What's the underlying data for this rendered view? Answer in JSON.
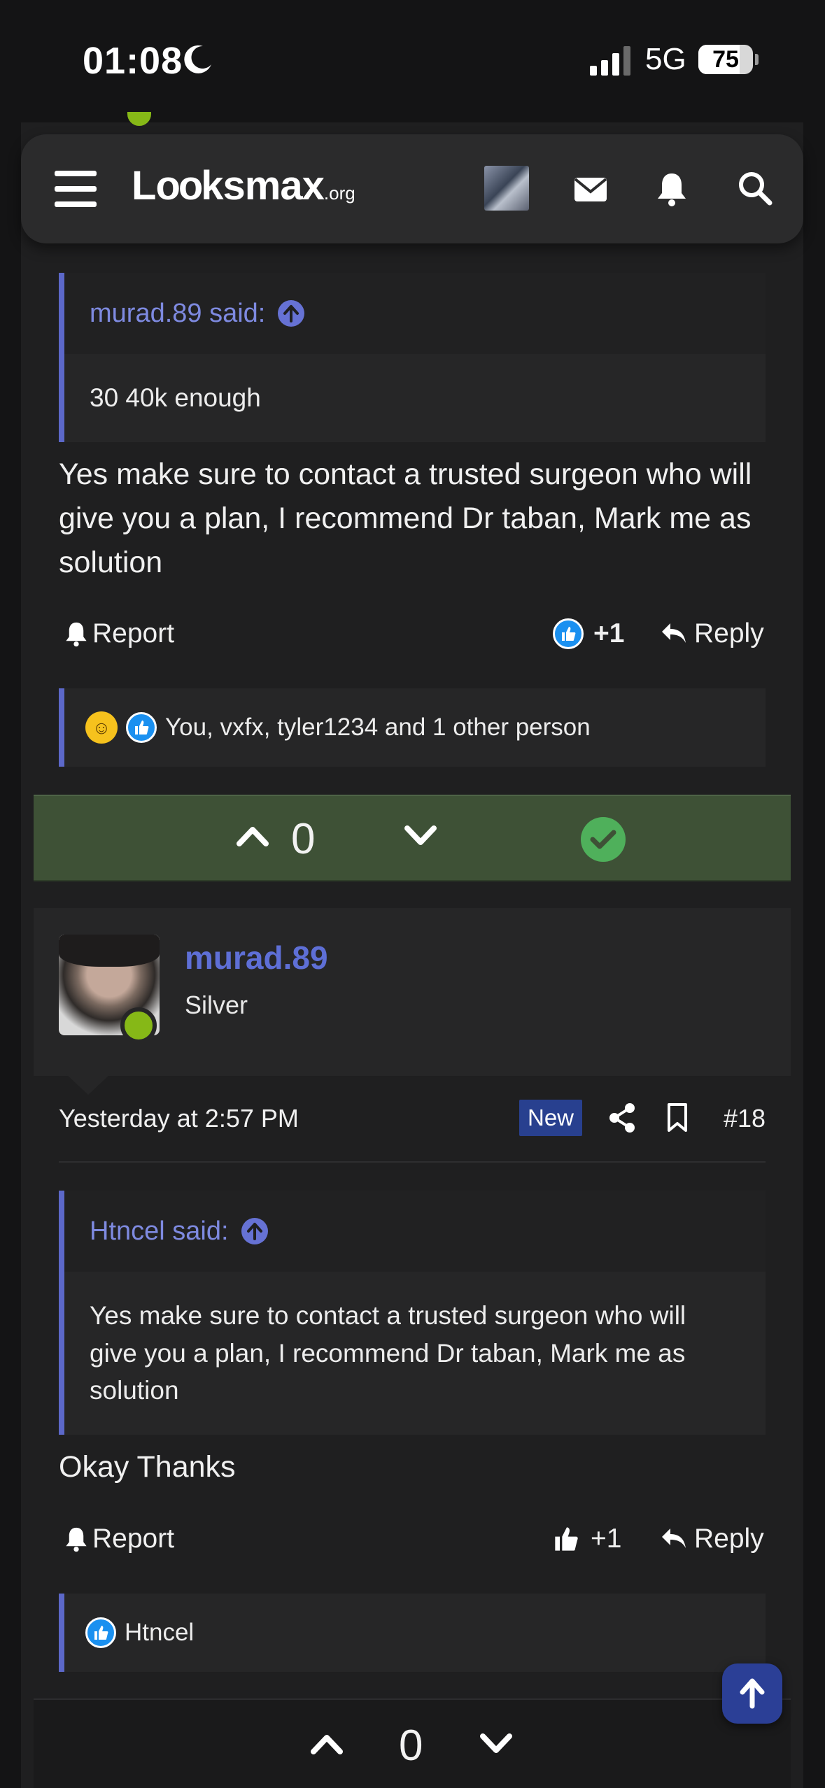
{
  "status_bar": {
    "time": "01:08",
    "network": "5G",
    "battery": "75",
    "battery_level": 0.75
  },
  "header": {
    "logo_main_1": "L",
    "logo_oo": "oo",
    "logo_main_2": "ksmax",
    "logo_suffix": ".org",
    "icons": [
      "menu-icon",
      "avatar",
      "mail-icon",
      "bell-icon",
      "search-icon"
    ]
  },
  "post1": {
    "quote_author": "murad.89 said:",
    "quote_text": "30 40k enough",
    "text": "Yes make sure to contact a trusted surgeon who will give you a plan, I recommend Dr taban, Mark me as solution",
    "report_label": "Report",
    "like_count": "+1",
    "reply_label": "Reply",
    "reactions_text": "You, vxfx, tyler1234 and 1 other person",
    "vote_count": "0"
  },
  "post2": {
    "username": "murad.89",
    "rank": "Silver",
    "date": "Yesterday at 2:57 PM",
    "new_badge": "New",
    "post_number": "#18",
    "quote_author": "Htncel said:",
    "quote_text": "Yes make sure to contact a trusted surgeon who will give you a plan, I recommend Dr taban, Mark me as solution",
    "text": "Okay Thanks",
    "report_label": "Report",
    "like_count": "+1",
    "reply_label": "Reply",
    "reactions_text": "Htncel",
    "vote_count": "0"
  },
  "colors": {
    "accent": "#5c68c9",
    "solution_bg": "#3e5136",
    "online": "#86b817",
    "badge": "#28408f"
  }
}
